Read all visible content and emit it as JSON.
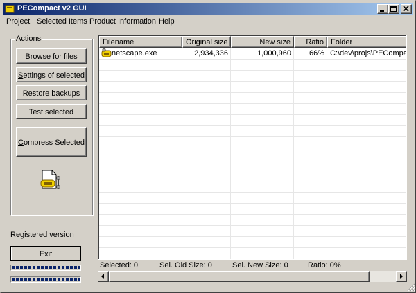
{
  "window": {
    "title": "PECompact v2 GUI"
  },
  "menu": [
    "Project",
    "Selected Items",
    "Product Information",
    "Help"
  ],
  "actions": {
    "group_label": "Actions",
    "browse": {
      "label": "Browse for files",
      "mnemonic": "B",
      "rest": "rowse for files"
    },
    "settings": {
      "label": "Settings of selected",
      "mnemonic": "S",
      "rest": "ettings of selected"
    },
    "restore": {
      "label": "Restore backups"
    },
    "test": {
      "label": "Test selected"
    },
    "compress": {
      "label": "Compress Selected",
      "mnemonic": "C",
      "rest": "ompress Selected"
    },
    "tool_icon": "compress-tool-icon"
  },
  "registered_text": "Registered version",
  "exit": {
    "label": "Exit"
  },
  "progress": [
    1.0,
    1.0
  ],
  "table": {
    "columns": [
      "Filename",
      "Original size",
      "New size",
      "Ratio",
      "Folder"
    ],
    "rows": [
      {
        "filename": "netscape.exe",
        "original": "2,934,336",
        "new": "1,000,960",
        "ratio": "66%",
        "folder": "C:\\dev\\projs\\PECompact"
      }
    ]
  },
  "status": {
    "selected": "Selected: 0",
    "old": "Sel. Old Size: 0",
    "new": "Sel. New Size: 0",
    "ratio": "Ratio: 0%",
    "sep": "|"
  },
  "colors": {
    "title_start": "#0a246a",
    "title_end": "#a6caf0",
    "face": "#d4d0c8",
    "progress": "#0a246a"
  }
}
